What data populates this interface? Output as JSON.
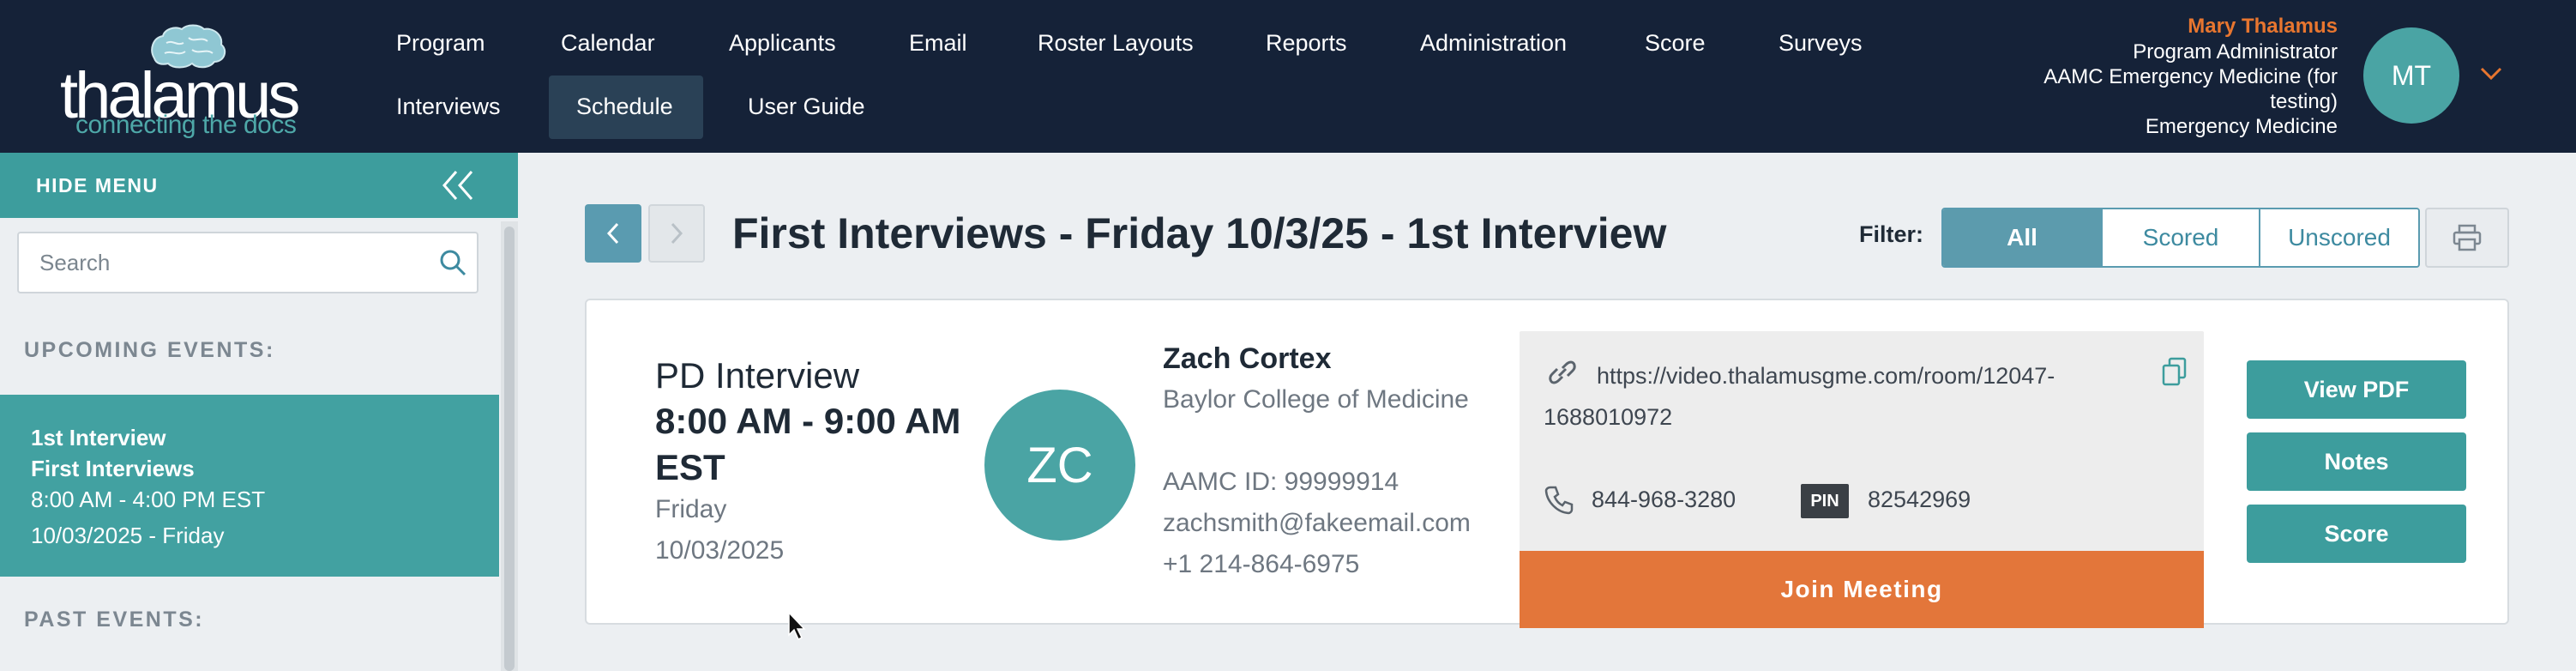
{
  "brand": {
    "name": "thalamus",
    "tagline": "connecting the docs"
  },
  "nav": {
    "row1": [
      "Program",
      "Calendar",
      "Applicants",
      "Email",
      "Roster Layouts",
      "Reports",
      "Administration",
      "Score",
      "Surveys"
    ],
    "row2": [
      "Interviews",
      "Schedule",
      "User Guide"
    ],
    "active": "Schedule"
  },
  "user": {
    "name": "Mary Thalamus",
    "role": "Program Administrator",
    "program_line1": "AAMC Emergency Medicine (for",
    "program_line2": "testing)",
    "specialty": "Emergency Medicine",
    "initials": "MT"
  },
  "sidebar": {
    "hide_label": "HIDE MENU",
    "search_placeholder": "Search",
    "upcoming_label": "UPCOMING EVENTS:",
    "past_label": "PAST EVENTS:",
    "upcoming_events": [
      {
        "title": "1st Interview",
        "subtitle": "First Interviews",
        "time": "8:00 AM - 4:00 PM EST",
        "date": "10/03/2025 - Friday"
      }
    ]
  },
  "main": {
    "title": "First Interviews - Friday 10/3/25 - 1st Interview",
    "filter_label": "Filter:",
    "filters": [
      "All",
      "Scored",
      "Unscored"
    ],
    "active_filter": "All"
  },
  "interview": {
    "type": "PD Interview",
    "time": "8:00 AM - 9:00 AM EST",
    "day": "Friday",
    "date": "10/03/2025",
    "candidate": {
      "initials": "ZC",
      "name": "Zach Cortex",
      "school": "Baylor College of Medicine",
      "aamc_id": "AAMC ID: 99999914",
      "email": "zachsmith@fakeemail.com",
      "phone": "+1 214-864-6975"
    },
    "meeting": {
      "url": "https://video.thalamusgme.com/room/12047-1688010972",
      "phone": "844-968-3280",
      "pin_label": "PIN",
      "pin": "82542969",
      "join_label": "Join Meeting"
    },
    "actions": [
      "View PDF",
      "Notes",
      "Score"
    ]
  },
  "colors": {
    "header_bg": "#152238",
    "teal": "#3d9d9d",
    "orange": "#e3763a",
    "filter_blue": "#5c9bad"
  },
  "icons": [
    "brain-logo-icon",
    "chevron-down-icon",
    "double-chevron-left-icon",
    "search-icon",
    "chevron-left-icon",
    "chevron-right-icon",
    "printer-icon",
    "link-icon",
    "copy-icon",
    "phone-icon",
    "mouse-cursor-icon"
  ]
}
